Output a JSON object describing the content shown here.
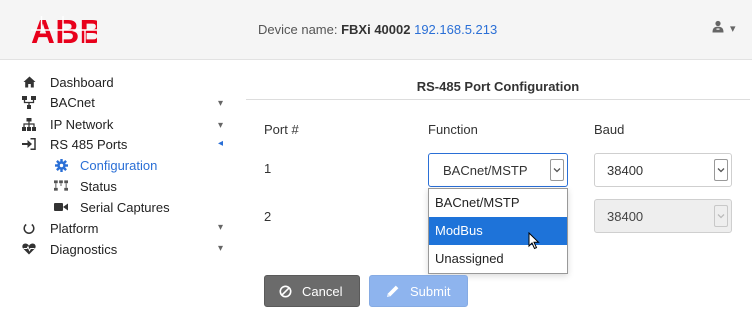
{
  "header": {
    "device_label": "Device name: ",
    "device_name": "FBXi 40002",
    "device_ip": "192.168.5.213",
    "user_icon": "user-icon",
    "menu_caret": "▾",
    "logo_text": "ABB"
  },
  "sidebar": {
    "items": [
      {
        "label": "Dashboard",
        "icon": "home-icon"
      },
      {
        "label": "BACnet",
        "icon": "network-tree-icon",
        "caret": "▾"
      },
      {
        "label": "IP Network",
        "icon": "sitemap-icon",
        "caret": "▾"
      },
      {
        "label": "RS 485 Ports",
        "icon": "sign-in-icon",
        "caret": "◂",
        "expanded": true
      },
      {
        "label": "Configuration",
        "icon": "gear-icon",
        "active": true
      },
      {
        "label": "Status",
        "icon": "status-network-icon"
      },
      {
        "label": "Serial Captures",
        "icon": "video-camera-icon"
      },
      {
        "label": "Platform",
        "icon": "power-icon",
        "caret": "▾"
      },
      {
        "label": "Diagnostics",
        "icon": "heartbeat-icon",
        "caret": "▾"
      }
    ]
  },
  "main": {
    "title": "RS-485 Port Configuration",
    "columns": {
      "port": "Port #",
      "function": "Function",
      "baud": "Baud"
    },
    "rows": [
      {
        "port": "1",
        "function": "BACnet/MSTP",
        "baud": "38400"
      },
      {
        "port": "2",
        "baud": "38400"
      }
    ],
    "dropdown_options": [
      "BACnet/MSTP",
      "ModBus",
      "Unassigned"
    ],
    "highlighted_option": "ModBus",
    "cancel_label": "Cancel",
    "submit_label": "Submit"
  },
  "colors": {
    "accent": "#2a6fd6",
    "highlight": "#1e73d9",
    "cancel_bg": "#6b6b6b",
    "submit_bg": "#8eb4ee",
    "logo_red": "#e8001b"
  }
}
